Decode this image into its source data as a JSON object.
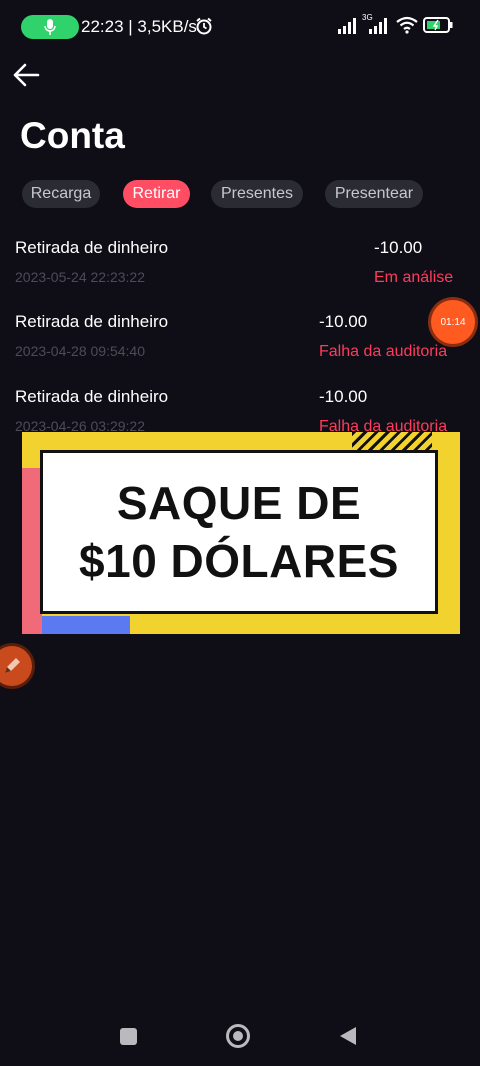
{
  "status": {
    "time_speed": "22:23 | 3,5KB/s",
    "network_tag": "3G"
  },
  "page": {
    "title": "Conta"
  },
  "tabs": [
    {
      "label": "Recarga",
      "active": false
    },
    {
      "label": "Retirar",
      "active": true
    },
    {
      "label": "Presentes",
      "active": false
    },
    {
      "label": "Presentear",
      "active": false
    }
  ],
  "records": [
    {
      "label": "Retirada de dinheiro",
      "date": "2023-05-24 22:23:22",
      "amount": "-10.00",
      "status": "Em análise"
    },
    {
      "label": "Retirada de dinheiro",
      "date": "2023-04-28 09:54:40",
      "amount": "-10.00",
      "status": "Falha da auditoria"
    },
    {
      "label": "Retirada de dinheiro",
      "date": "2023-04-26 03:29:22",
      "amount": "-10.00",
      "status": "Falha da auditoria"
    }
  ],
  "timer": {
    "value": "01:14"
  },
  "banner": {
    "line1": "SAQUE DE",
    "line2": "$10 DÓLARES"
  },
  "colors": {
    "accent": "#ff4d63",
    "status_red": "#ff3b5c",
    "background": "#0f0e17"
  },
  "icons": [
    "back-arrow-icon",
    "microphone-icon",
    "alarm-icon",
    "signal-icon",
    "wifi-icon",
    "battery-icon",
    "pencil-icon"
  ]
}
